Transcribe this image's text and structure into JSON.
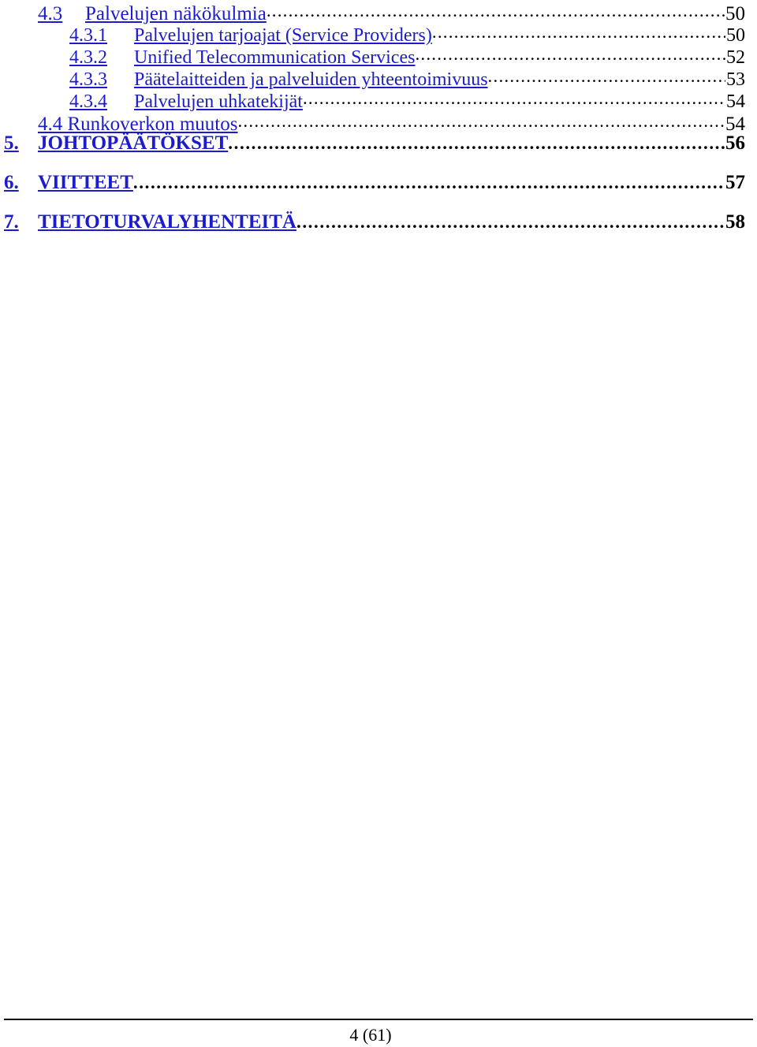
{
  "document": {
    "type": "table-of-contents",
    "text_color_link": "#1c1ccc",
    "text_color_body": "#000000"
  },
  "toc": {
    "entries": [
      {
        "level": "lvl1",
        "number": "4.3",
        "title": "Palvelujen näkökulmia",
        "page": "50"
      },
      {
        "level": "lvl2",
        "number": "4.3.1",
        "title": "Palvelujen tarjoajat (Service Providers)",
        "page": "50"
      },
      {
        "level": "lvl2",
        "number": "4.3.2",
        "title": "Unified Telecommunication Services",
        "page": "52"
      },
      {
        "level": "lvl2",
        "number": "4.3.3",
        "title": "Päätelaitteiden ja palveluiden yhteentoimivuus",
        "page": "53"
      },
      {
        "level": "lvl2",
        "number": "4.3.4",
        "title": "Palvelujen uhkatekijät",
        "page": "54"
      },
      {
        "level": "lvl1s",
        "number": "",
        "title": "4.4 Runkoverkon muutos",
        "page": "54"
      },
      {
        "level": "chap",
        "number": "5.",
        "title": "JOHTOPÄÄTÖKSET",
        "page": "56"
      },
      {
        "level": "chap",
        "number": "6.",
        "title": "VIITTEET",
        "page": "57"
      },
      {
        "level": "chap",
        "number": "7.",
        "title": "TIETOTURVALYHENTEITÄ",
        "page": "58"
      }
    ]
  },
  "footer": {
    "page_label": "4 (61)"
  }
}
